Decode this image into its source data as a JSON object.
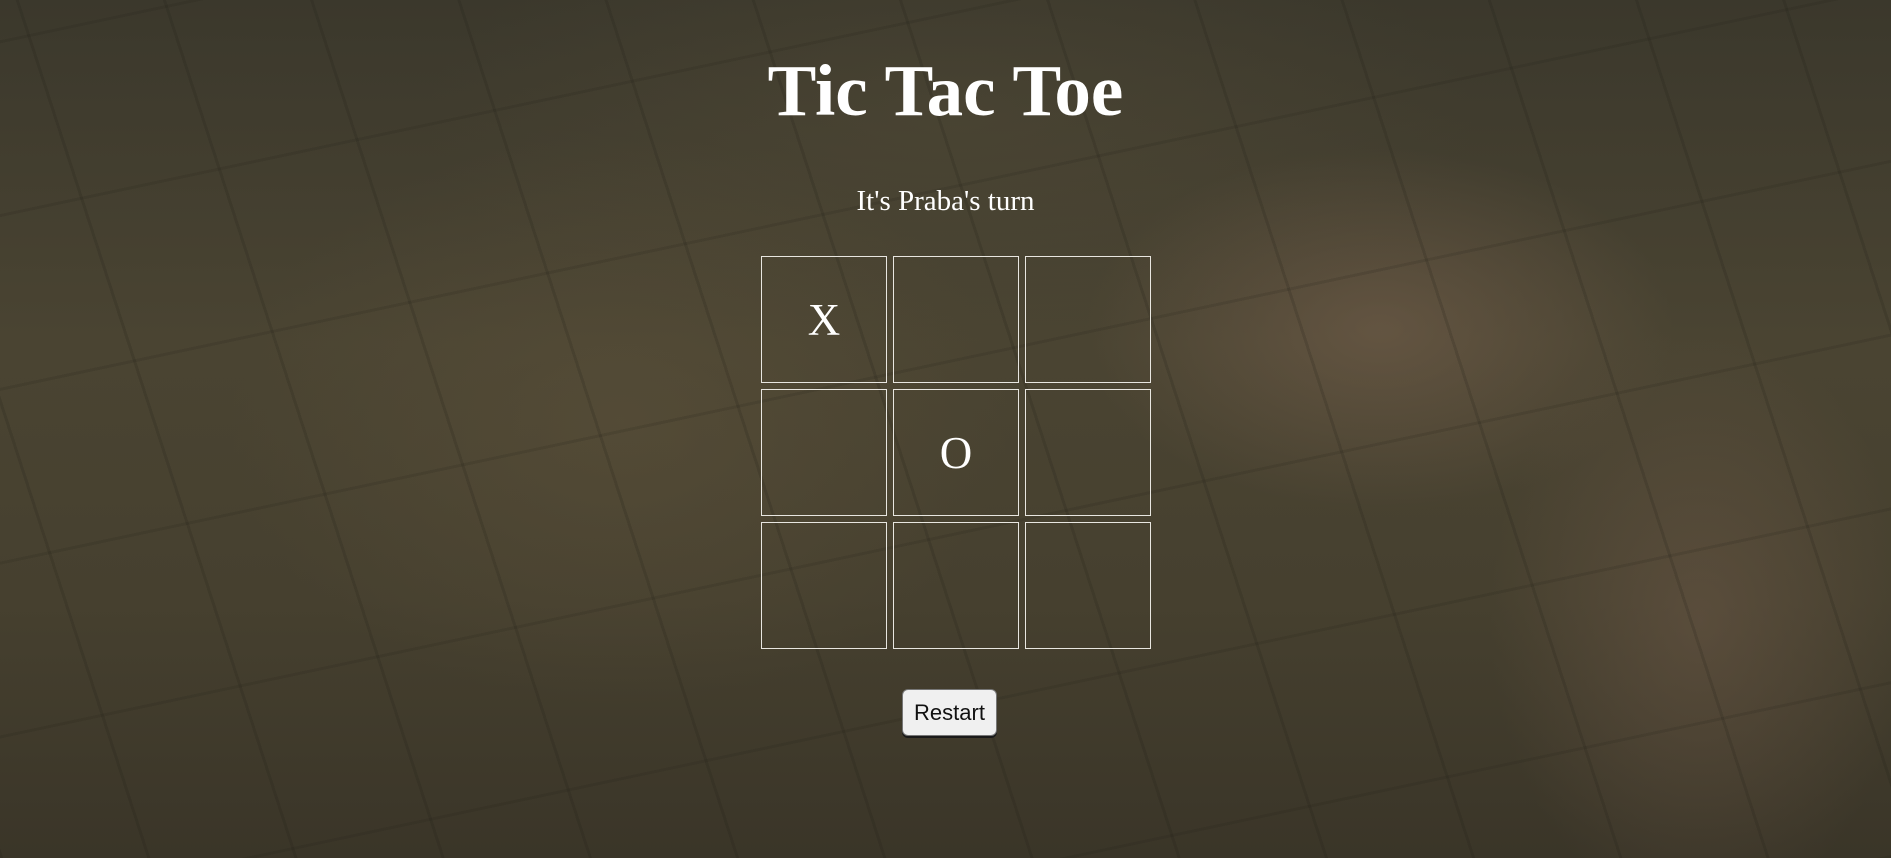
{
  "page": {
    "title": "Tic Tac Toe",
    "status": "It's Praba's turn"
  },
  "board": {
    "cells": [
      "X",
      "",
      "",
      "",
      "O",
      "",
      "",
      "",
      ""
    ]
  },
  "controls": {
    "restart_label": "Restart"
  },
  "colors": {
    "text": "#ffffff",
    "cell_border": "#e8e6e0",
    "button_bg": "#f0f0f0",
    "background_tint": "#46402f"
  }
}
